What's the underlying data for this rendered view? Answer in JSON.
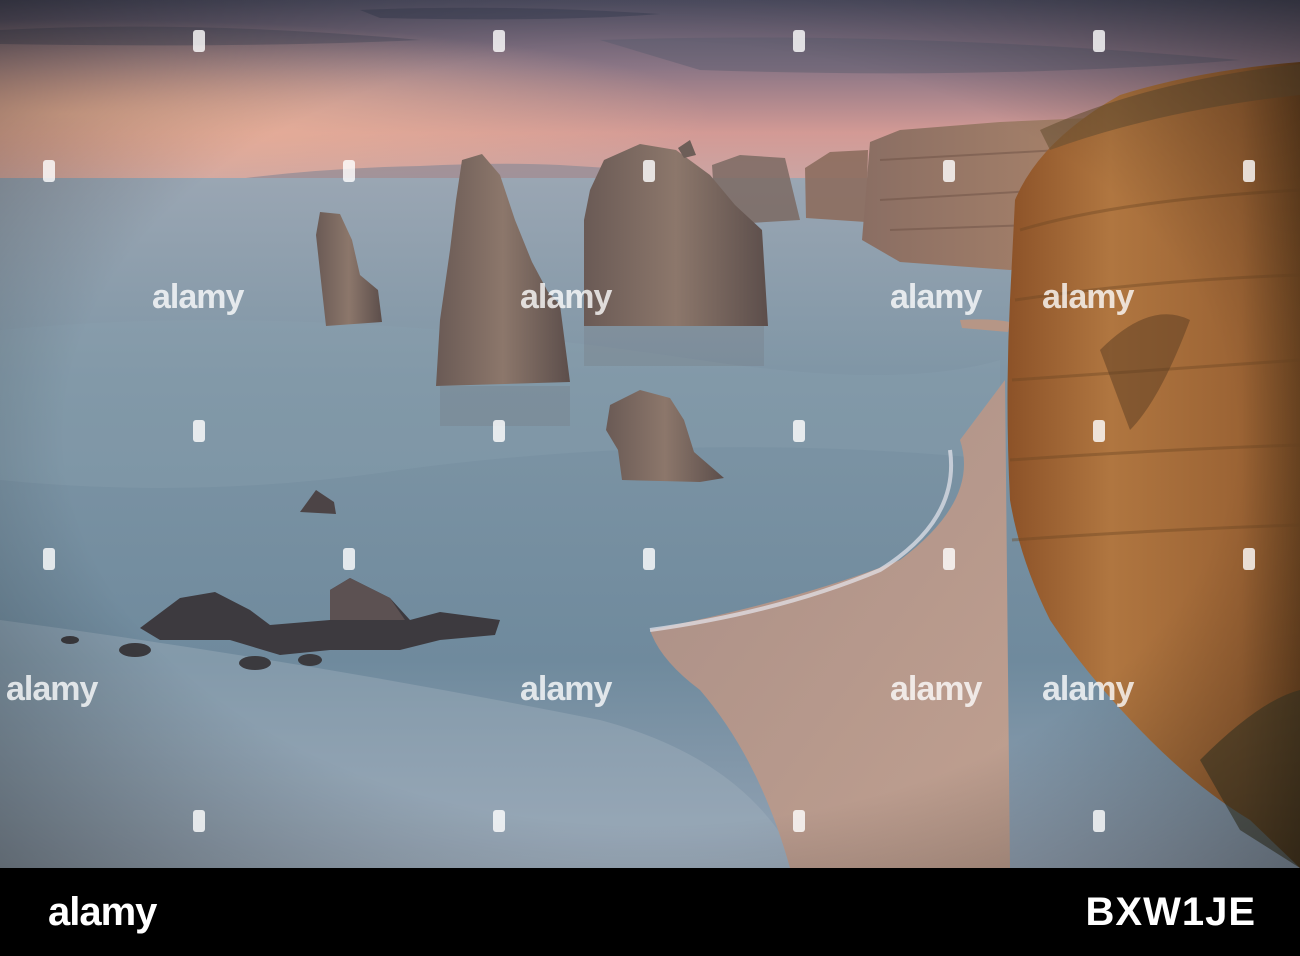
{
  "image": {
    "subject": "",
    "colors": {
      "sky_top": "#4c4e63",
      "sky_glow": "#e0a69a",
      "sea": "#7f96a6",
      "sand": "#b39386",
      "cliff": "#a46a3a",
      "stack": "#7d6a60"
    }
  },
  "watermark": {
    "text": "alamy",
    "footer_logo": "alamy",
    "image_id": "BXW1JE"
  }
}
